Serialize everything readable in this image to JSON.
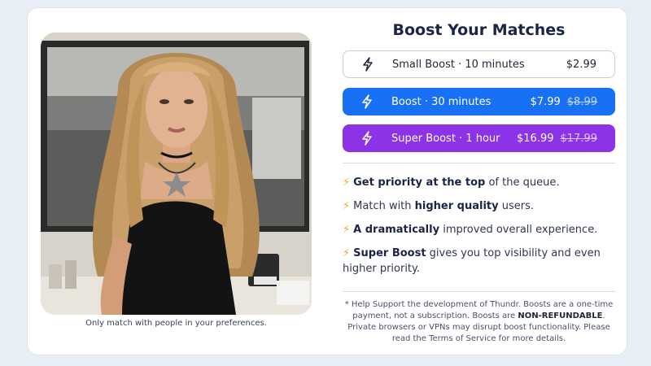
{
  "title": "Boost Your Matches",
  "photo_caption": "Only match with people in your preferences.",
  "options": [
    {
      "label": "Small Boost · 10 minutes",
      "price": "$2.99",
      "old_price": ""
    },
    {
      "label": "Boost · 30 minutes",
      "price": "$7.99",
      "old_price": "$8.99"
    },
    {
      "label": "Super Boost · 1 hour",
      "price": "$16.99",
      "old_price": "$17.99"
    }
  ],
  "features": [
    {
      "bold": "Get priority at the top",
      "pre": "",
      "post": " of the queue."
    },
    {
      "pre": "Match with ",
      "bold": "higher quality",
      "post": " users."
    },
    {
      "bold": "A dramatically",
      "pre": "",
      "post": " improved overall experience."
    },
    {
      "bold": "Super Boost",
      "pre": "",
      "post": " gives you top visibility and even higher priority."
    }
  ],
  "note": {
    "part1": "* Help Support the development of Thundr. Boosts are a one-time payment, not a subscription. Boosts are ",
    "bold": "NON-REFUNDABLE",
    "part2": ". Private browsers or VPNs may disrupt boost functionality. Please read the Terms of Service for more details."
  },
  "colors": {
    "boost_blue": "#1871f5",
    "super_purple": "#8c33e8",
    "bolt_yellow": "#f5a623"
  },
  "icons": {
    "bolt": "lightning-bolt-icon"
  }
}
